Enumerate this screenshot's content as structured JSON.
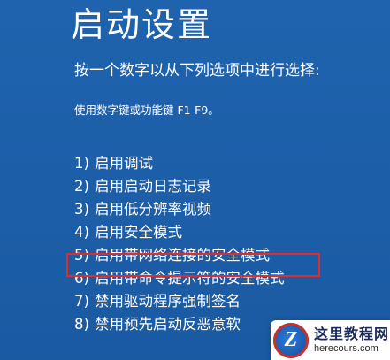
{
  "title": "启动设置",
  "prompt": "按一个数字以从下列选项中进行选择:",
  "hint": "使用数字键或功能键 F1-F9。",
  "options": [
    {
      "num": "1)",
      "label": "启用调试"
    },
    {
      "num": "2)",
      "label": "启用启动日志记录"
    },
    {
      "num": "3)",
      "label": "启用低分辨率视频"
    },
    {
      "num": "4)",
      "label": "启用安全模式"
    },
    {
      "num": "5)",
      "label": "启用带网络连接的安全模式"
    },
    {
      "num": "6)",
      "label": "启用带命令提示符的安全模式"
    },
    {
      "num": "7)",
      "label": "禁用驱动程序强制签名"
    },
    {
      "num": "8)",
      "label": "禁用预先启动反恶意软"
    }
  ],
  "highlighted_option": "5)",
  "watermark": {
    "logo_letter": "Z",
    "name": "这里教程网",
    "url": "herecours.com"
  },
  "colors": {
    "background": "#1d5fa7",
    "text": "#ffffff",
    "highlight_border": "#e22b2b"
  }
}
